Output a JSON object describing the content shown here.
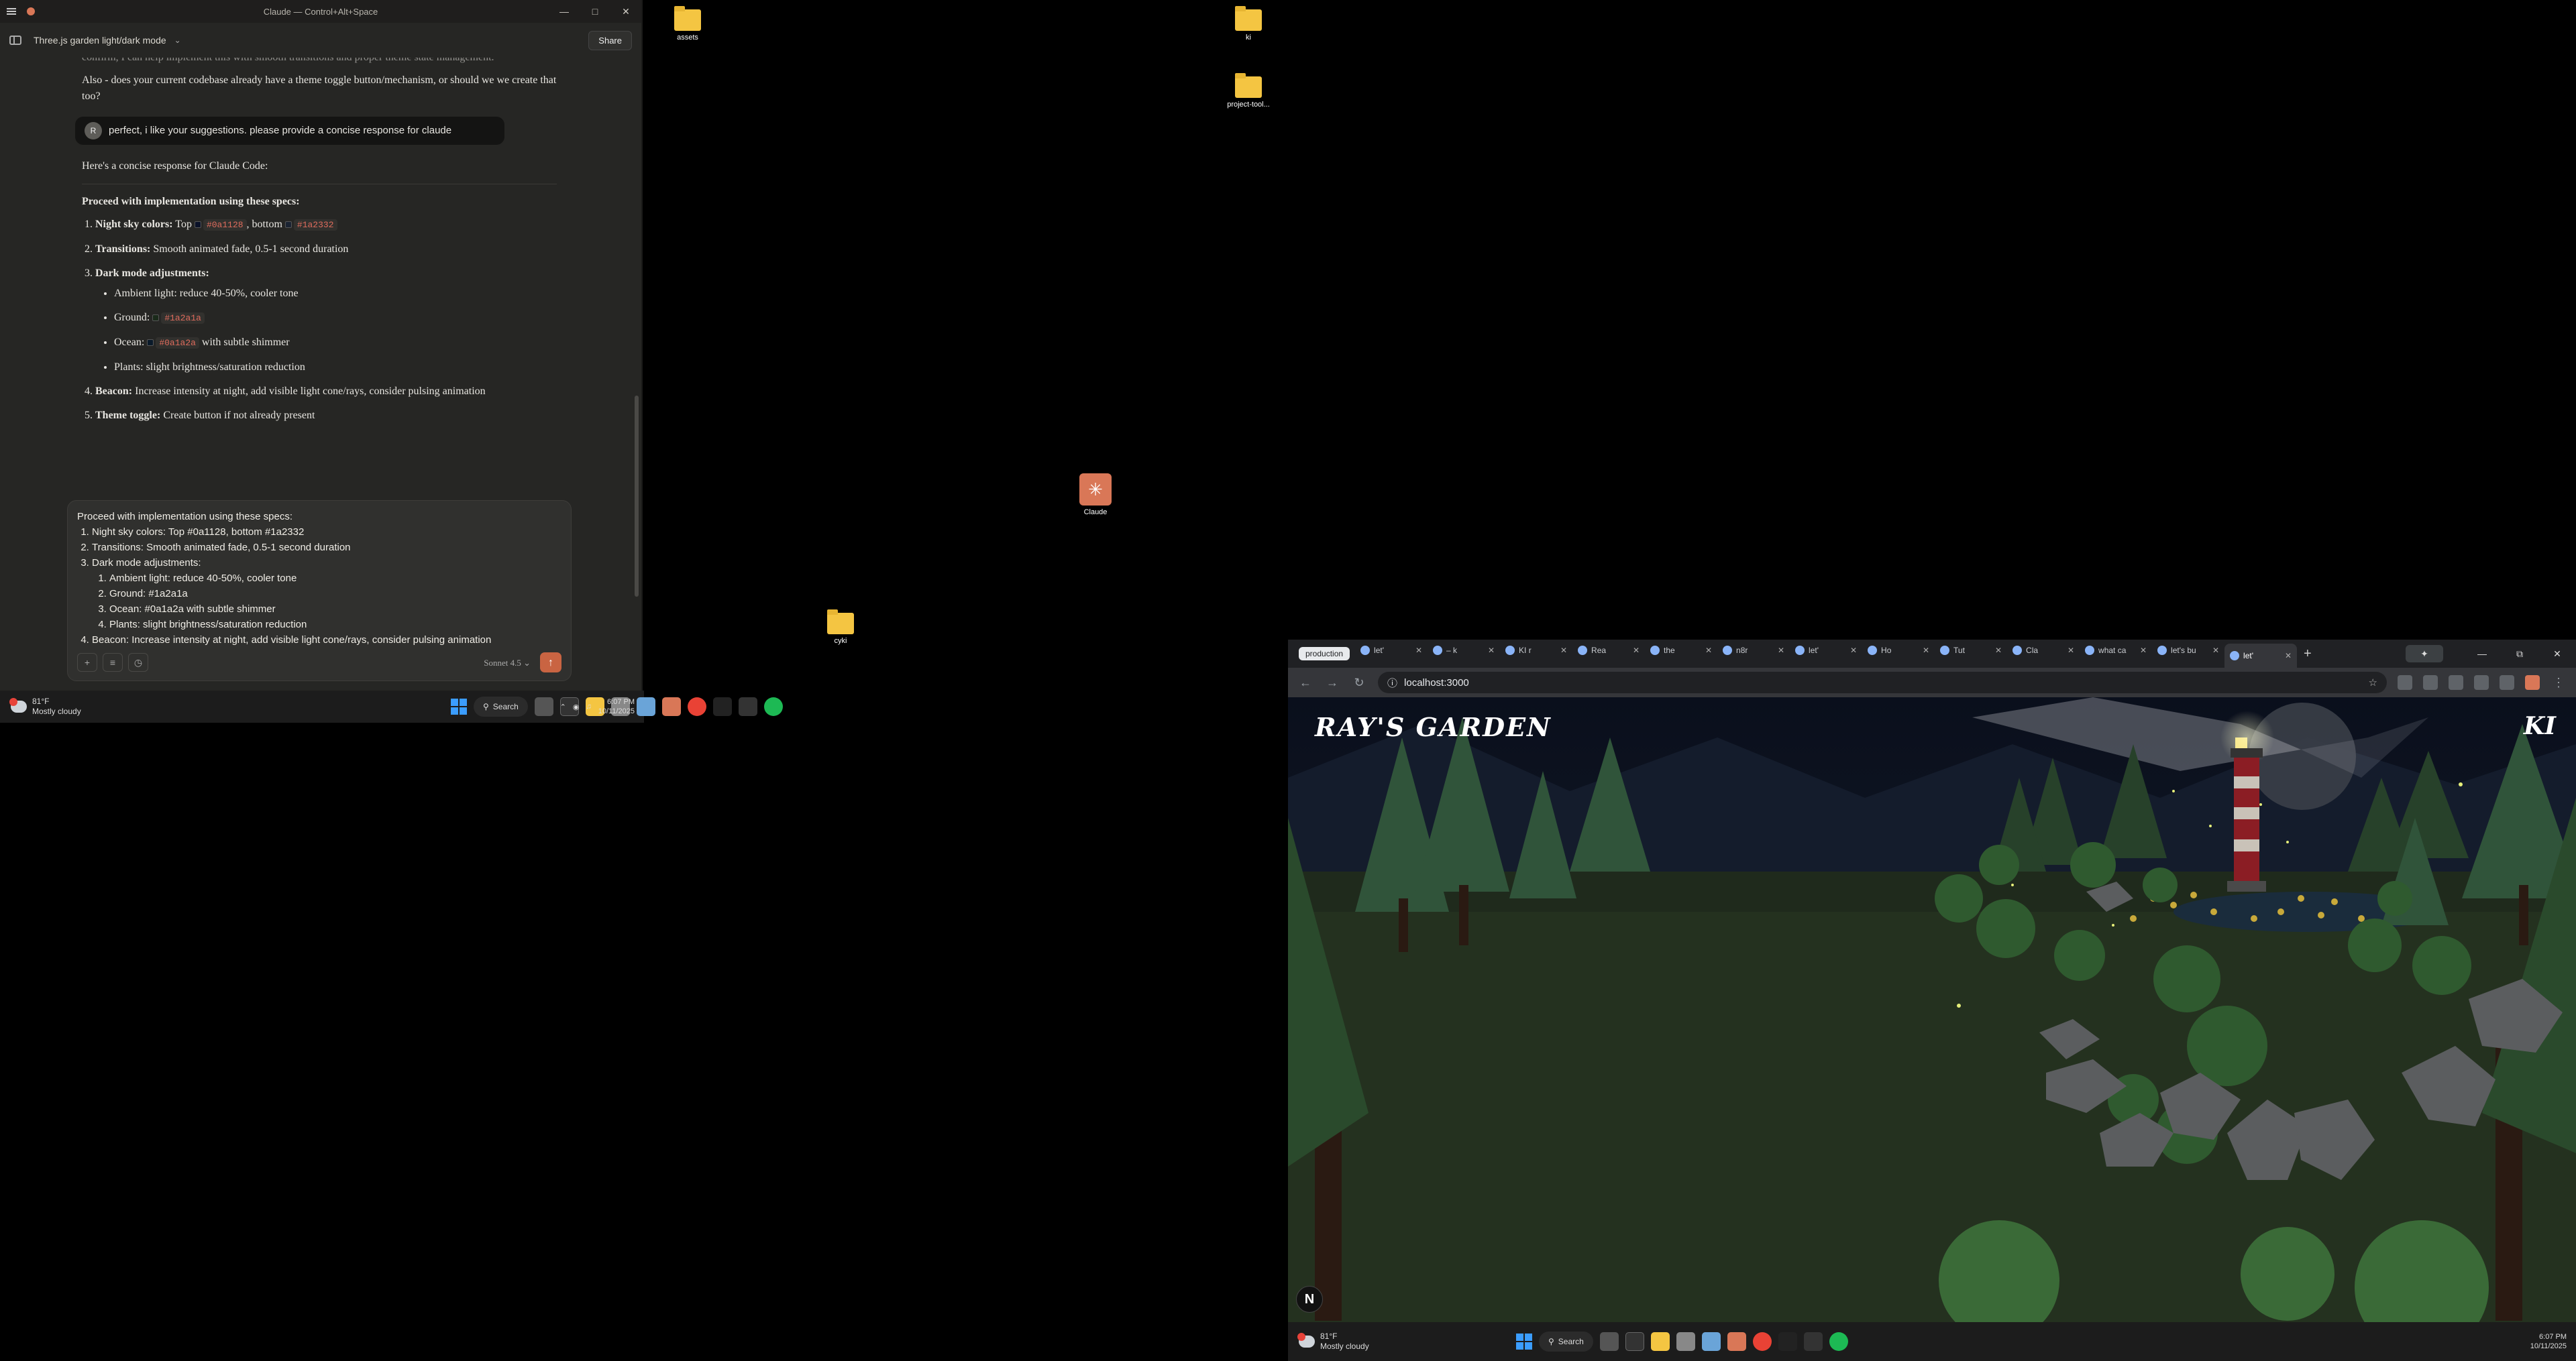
{
  "claude": {
    "window_title": "Claude — Control+Alt+Space",
    "conversation_title": "Three.js garden light/dark mode",
    "share_label": "Share",
    "faded_text": "confirm, I can help implement this with smooth transitions and proper theme state management.",
    "question_text": "Also - does your current codebase already have a theme toggle button/mechanism, or should we we create that too?",
    "user_message": "perfect, i like your suggestions. please provide a concise response for claude",
    "user_initial": "R",
    "intro": "Here's a concise response for Claude Code:",
    "heading": "Proceed with implementation using these specs:",
    "specs": {
      "s1_label": "Night sky colors:",
      "s1_top": "Top",
      "s1_top_code": "#0a1128",
      "s1_bottom": ", bottom",
      "s1_bottom_code": "#1a2332",
      "s2_label": "Transitions:",
      "s2_text": "Smooth animated fade, 0.5-1 second duration",
      "s3_label": "Dark mode adjustments:",
      "s3_a": "Ambient light: reduce 40-50%, cooler tone",
      "s3_b_label": "Ground:",
      "s3_b_code": "#1a2a1a",
      "s3_c_label": "Ocean:",
      "s3_c_code": "#0a1a2a",
      "s3_c_tail": "with subtle shimmer",
      "s3_d": "Plants: slight brightness/saturation reduction",
      "s4_label": "Beacon:",
      "s4_text": "Increase intensity at night, add visible light cone/rays, consider pulsing animation",
      "s5_label": "Theme toggle:",
      "s5_text": "Create button if not already present"
    },
    "composer": {
      "heading": "Proceed with implementation using these specs:",
      "l1": "Night sky colors: Top #0a1128, bottom #1a2332",
      "l2": "Transitions: Smooth animated fade, 0.5-1 second duration",
      "l3": "Dark mode adjustments:",
      "l3a": "Ambient light: reduce 40-50%, cooler tone",
      "l3b": "Ground: #1a2a1a",
      "l3c": "Ocean: #0a1a2a with subtle shimmer",
      "l3d": "Plants: slight brightness/saturation reduction",
      "l4": "Beacon: Increase intensity at night, add visible light cone/rays, consider pulsing animation"
    },
    "model": "Sonnet 4.5",
    "colors": {
      "sky_top": "#0a1128",
      "sky_bottom": "#1a2332",
      "ground": "#1a2a1a",
      "ocean": "#0a1a2a",
      "accent": "#c96442"
    }
  },
  "desktop": {
    "icons": [
      "assets",
      "ki",
      "project-tool...",
      "Claude",
      "cyki"
    ]
  },
  "taskbar": {
    "temp": "81°F",
    "condition": "Mostly cloudy",
    "search": "Search",
    "time": "6:07 PM",
    "date": "10/11/2025"
  },
  "browser": {
    "tab_group": "production",
    "tabs": [
      "let'",
      "– k",
      "KI r",
      "Rea",
      "the",
      "n8r",
      "let'",
      "Ho",
      "Tut",
      "Cla",
      "what ca",
      "let's bu",
      "let'"
    ],
    "url": "localhost:3000"
  },
  "site": {
    "title": "RAY'S GARDEN",
    "mark": "KI",
    "badge": "N"
  }
}
